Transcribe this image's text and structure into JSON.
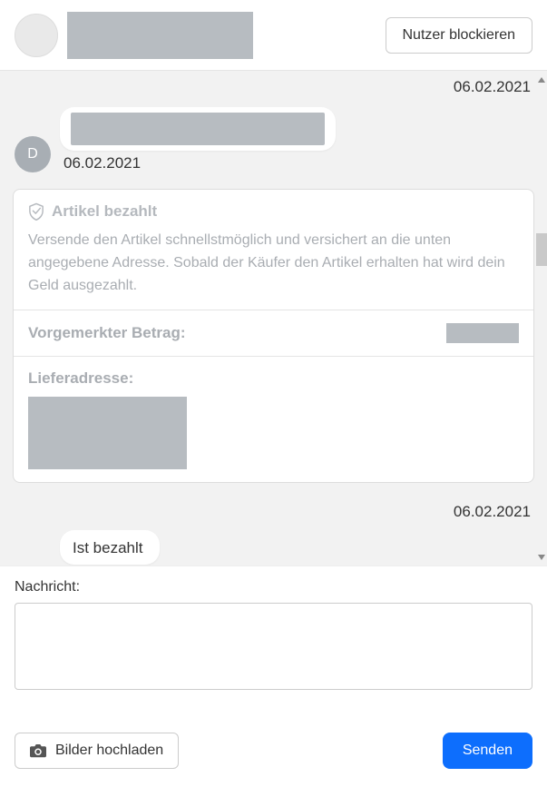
{
  "header": {
    "block_label": "Nutzer blockieren"
  },
  "dates": {
    "top": "06.02.2021",
    "first_msg": "06.02.2021",
    "second": "06.02.2021"
  },
  "avatar": {
    "initial": "D"
  },
  "card": {
    "title": "Artikel bezahlt",
    "body": "Versende den Artikel schnellstmöglich und versichert an die unten angegebene Adresse. Sobald der Käufer den Artikel erhalten hat wird dein Geld ausgezahlt.",
    "amount_label": "Vorgemerkter Betrag:",
    "address_label": "Lieferadresse:"
  },
  "messages": {
    "second_text": "Ist bezahlt"
  },
  "compose": {
    "label": "Nachricht:",
    "upload_label": "Bilder hochladen",
    "send_label": "Senden"
  }
}
